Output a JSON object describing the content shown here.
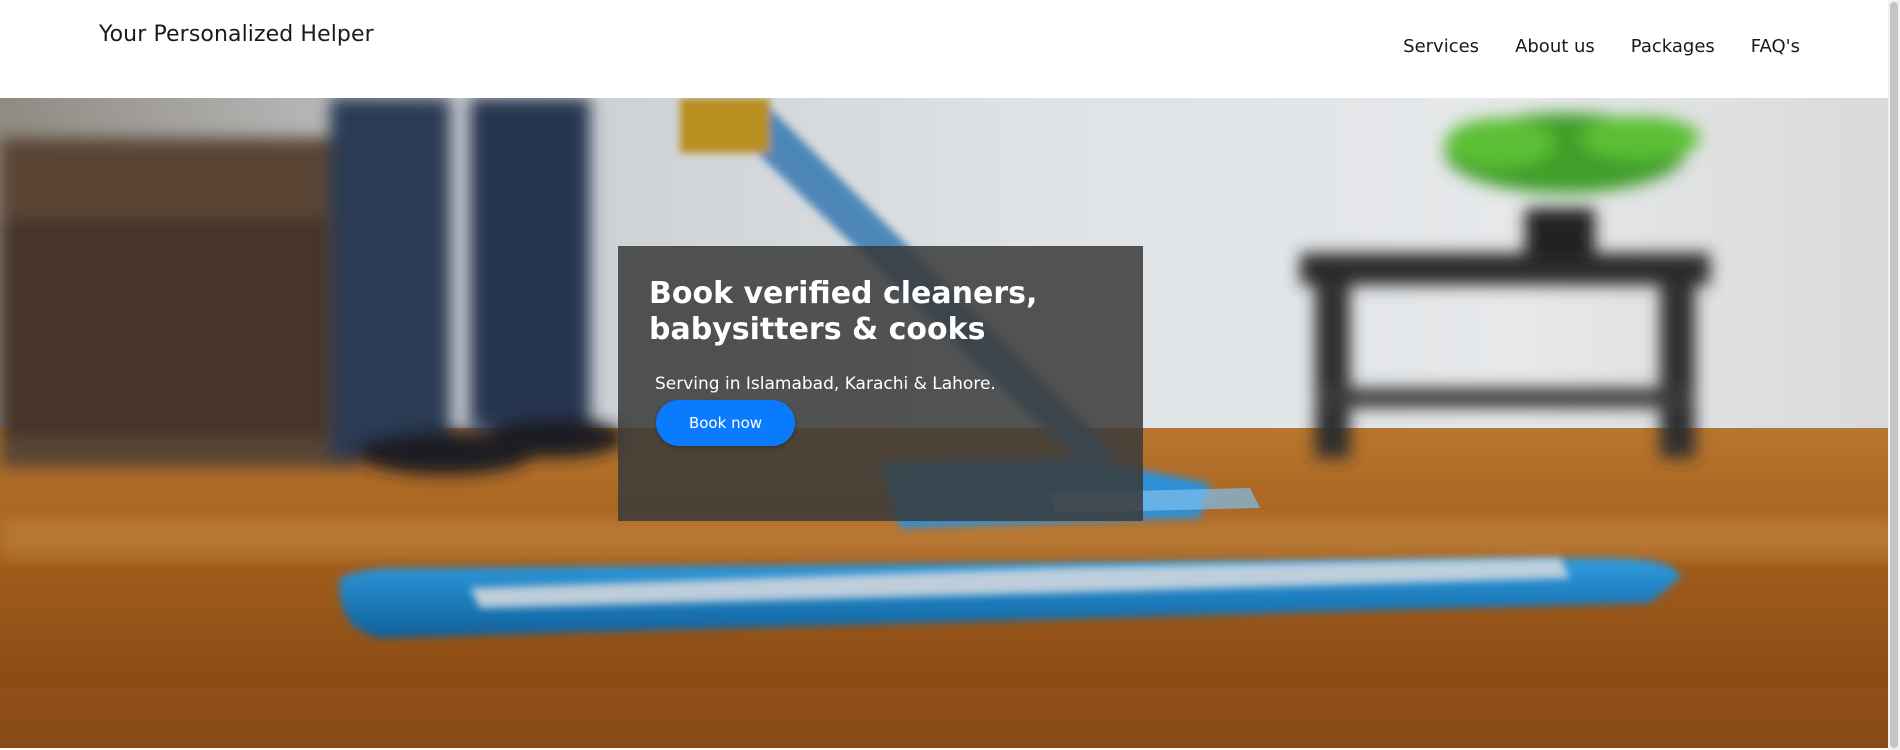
{
  "header": {
    "brand": "Your Personalized Helper",
    "nav": [
      "Services",
      "About us",
      "Packages",
      "FAQ's"
    ]
  },
  "hero": {
    "image_subject": "mop-cleaning-wooden-floor",
    "headline": "Book verified cleaners, babysitters & cooks",
    "subtitle": "Serving in Islamabad, Karachi & Lahore.",
    "cta_label": "Book now"
  },
  "colors": {
    "accent": "#0a7bff",
    "overlay": "#3a3a3a",
    "header_bg": "#ffffff",
    "text_dark": "#1a1a1a"
  }
}
